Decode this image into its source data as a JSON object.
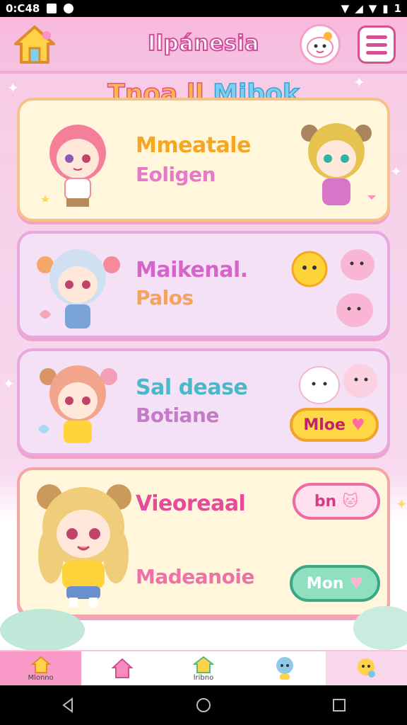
{
  "status_bar": {
    "time": "0:C48",
    "battery": "1"
  },
  "header": {
    "title": "Ilpánesia"
  },
  "section": {
    "title_part1": "Tnoa ll",
    "title_part2": "Mibok"
  },
  "cards": [
    {
      "name": "Mmeatale",
      "sub": "Eoligen",
      "name_color": "#f5a623",
      "sub_color": "#e878c8"
    },
    {
      "name": "Maikenal.",
      "sub": "Palos",
      "name_color": "#d665c9",
      "sub_color": "#f5a25d"
    },
    {
      "name": "Sal dease",
      "sub": "Botiane",
      "name_color": "#4ab8c9",
      "sub_color": "#c57ac8",
      "button": "Mloe"
    },
    {
      "name": "Vieoreaal",
      "sub": "Madeanoie",
      "name_color": "#e64a9a",
      "sub_color": "#f070a8",
      "button_top": "bn",
      "button_bottom": "Mon"
    }
  ],
  "bottom_nav": [
    {
      "label": "Mlonno",
      "icon": "home-icon"
    },
    {
      "label": "",
      "icon": "house-pink-icon"
    },
    {
      "label": "lribno",
      "icon": "house-green-icon"
    },
    {
      "label": "",
      "icon": "character-icon"
    },
    {
      "label": "",
      "icon": "mascot-icon"
    }
  ]
}
